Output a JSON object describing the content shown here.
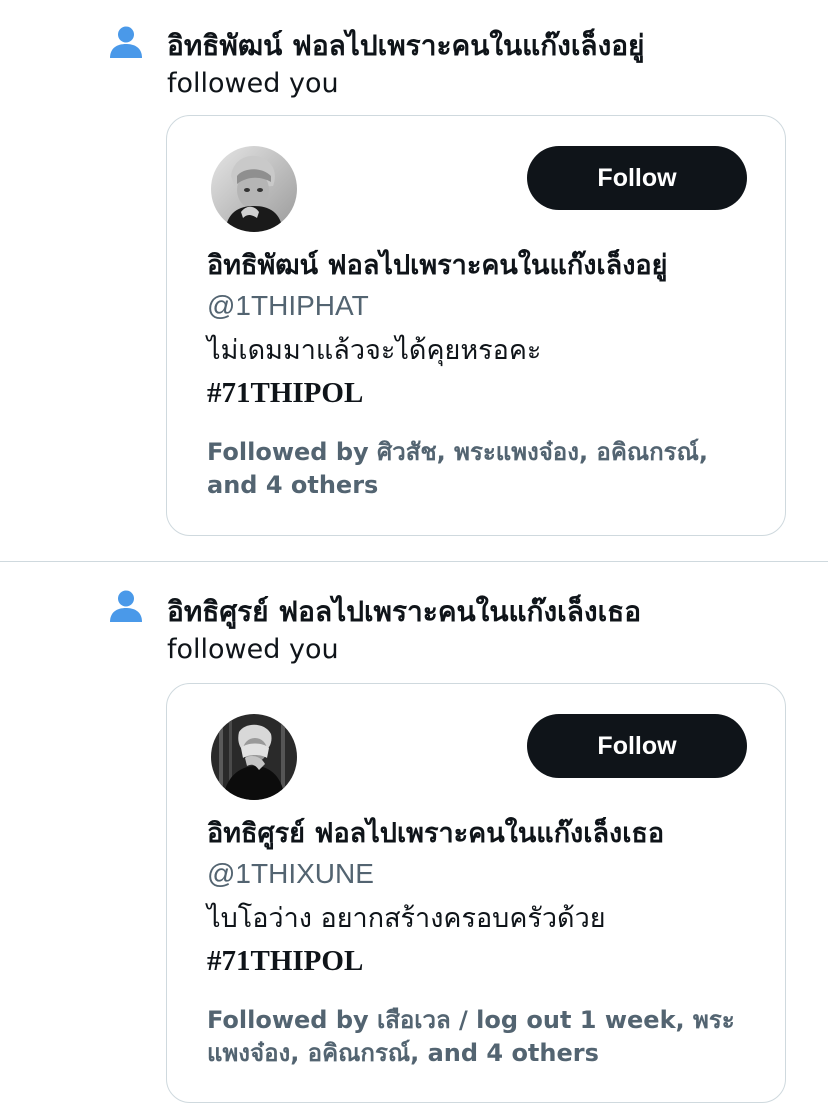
{
  "notifications": [
    {
      "name": "อิทธิพัฒน์ ฟอลไปเพราะคนในแก๊งเล็งอยู่",
      "action": "followed you",
      "card": {
        "name": "อิทธิพัฒน์ ฟอลไปเพราะคนในแก๊งเล็งอยู่",
        "handle": "@1THIPHAT",
        "bio_line": "ไม่เดมมาแล้วจะได้คุยหรอคะ",
        "hashtag": "#71THIPOL",
        "followed_by": "Followed by ศิวสัช, พระแพงจ๋อง, อคิณกรณ์, and 4 others",
        "follow_label": "Follow"
      }
    },
    {
      "name": "อิทธิศูรย์ ฟอลไปเพราะคนในแก๊งเล็งเธอ",
      "action": "followed you",
      "card": {
        "name": "อิทธิศูรย์ ฟอลไปเพราะคนในแก๊งเล็งเธอ",
        "handle": "@1THIXUNE",
        "bio_line": "ไบโอว่าง อยากสร้างครอบครัวด้วย",
        "hashtag": "#71THIPOL",
        "followed_by": "Followed by เสือเวล / log out 1 week, พระแพงจ๋อง, อคิณกรณ์, and 4 others",
        "follow_label": "Follow"
      }
    }
  ],
  "colors": {
    "icon_blue": "#4a99e9",
    "button_bg": "#0f1419",
    "secondary_text": "#536471",
    "border": "#cfd9de"
  },
  "icons": {
    "notification": "person-icon"
  }
}
